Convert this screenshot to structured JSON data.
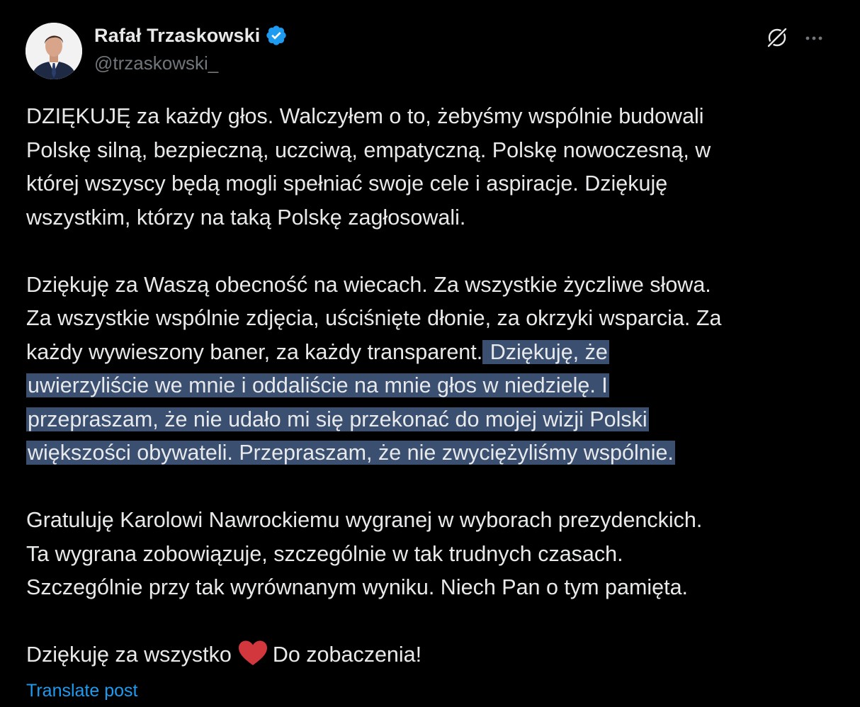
{
  "author": {
    "display_name": "Rafał Trzaskowski",
    "handle": "@trzaskowski_",
    "verified": true,
    "avatar": "profile-photo"
  },
  "header_icons": [
    "grok-icon",
    "more-icon"
  ],
  "post": {
    "paragraphs": [
      {
        "lines": [
          "DZIĘKUJĘ za każdy głos. Walczyłem o to, żebyśmy wspólnie budowali",
          "Polskę silną, bezpieczną, uczciwą, empatyczną. Polskę nowoczesną, w",
          "której wszyscy będą mogli spełniać swoje cele i aspiracje. Dziękuję",
          "wszystkim, którzy na taką Polskę zagłosowali."
        ]
      },
      {
        "line1": "Dziękuję za Waszą obecność na wiecach. Za wszystkie życzliwe słowa.",
        "line2": "Za wszystkie wspólnie zdjęcia, uściśnięte dłonie, za okrzyki wsparcia. Za",
        "line3_plain": "każdy wywieszony baner, za każdy transparent.",
        "line3_selected": " Dziękuję, że",
        "line4_selected": "uwierzyliście we mnie i oddaliście na mnie głos w niedzielę. I",
        "line5_selected": "przepraszam, że nie udało mi się przekonać do mojej wizji Polski",
        "line6_selected": "większości obywateli. Przepraszam, że nie zwyciężyliśmy wspólnie. "
      },
      {
        "lines": [
          "Gratuluję Karolowi Nawrockiemu wygranej w wyborach prezydenckich.",
          "Ta wygrana zobowiązuje, szczególnie w tak trudnych czasach.",
          "Szczególnie przy tak wyrównanym wyniku. Niech Pan o tym pamięta."
        ]
      },
      {
        "before_emoji": "Dziękuję za wszystko",
        "emoji": "heart-icon",
        "after_emoji": "Do zobaczenia!"
      }
    ]
  },
  "translate_label": "Translate post",
  "colors": {
    "background": "#000000",
    "text": "#e7e9ea",
    "secondary": "#71767b",
    "link": "#1d9bf0",
    "selection": "#3b4f70",
    "verified": "#1d9bf0",
    "heart": "#d1373d"
  }
}
